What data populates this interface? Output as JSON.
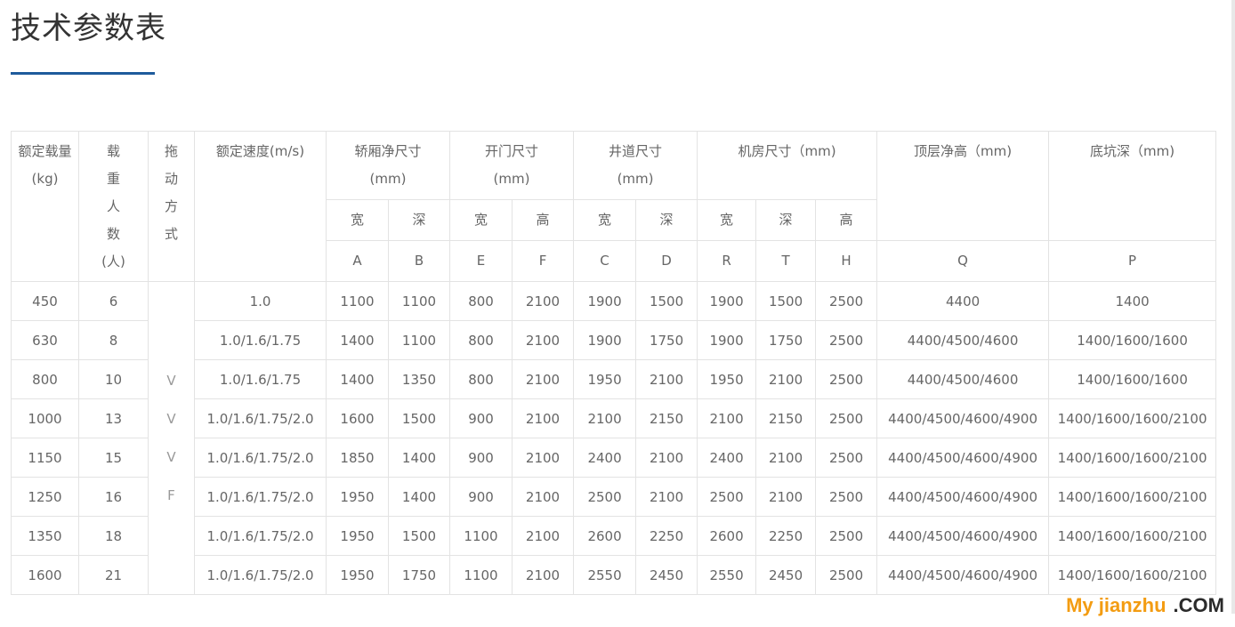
{
  "title": "技术参数表",
  "colors": {
    "accent": "#1f5b9c",
    "border": "#e3e3e3",
    "text": "#666666"
  },
  "table": {
    "headers": {
      "load": "额定载量(kg)",
      "persons": [
        "载",
        "重",
        "人",
        "数",
        "(人)"
      ],
      "drive": [
        "拖",
        "动",
        "方",
        "式"
      ],
      "speed": "额定速度(m/s)",
      "car": [
        "轿厢净尺寸",
        "(mm)"
      ],
      "door": [
        "开门尺寸",
        "(mm)"
      ],
      "shaft": [
        "井道尺寸",
        "(mm)"
      ],
      "machine": "机房尺寸（mm)",
      "overhead": "顶层净高（mm)",
      "pit": "底坑深（mm)"
    },
    "sub": [
      "宽",
      "深",
      "宽",
      "高",
      "宽",
      "深",
      "宽",
      "深",
      "高"
    ],
    "codes": [
      "A",
      "B",
      "E",
      "F",
      "C",
      "D",
      "R",
      "T",
      "H",
      "Q",
      "P"
    ],
    "drive_letters": [
      "V",
      "V",
      "V",
      "F"
    ],
    "rows": [
      {
        "load": "450",
        "persons": "6",
        "speed": "1.0",
        "A": "1100",
        "B": "1100",
        "E": "800",
        "F": "2100",
        "C": "1900",
        "D": "1500",
        "R": "1900",
        "T": "1500",
        "H": "2500",
        "Q": "4400",
        "P": "1400"
      },
      {
        "load": "630",
        "persons": "8",
        "speed": "1.0/1.6/1.75",
        "A": "1400",
        "B": "1100",
        "E": "800",
        "F": "2100",
        "C": "1900",
        "D": "1750",
        "R": "1900",
        "T": "1750",
        "H": "2500",
        "Q": "4400/4500/4600",
        "P": "1400/1600/1600"
      },
      {
        "load": "800",
        "persons": "10",
        "speed": "1.0/1.6/1.75",
        "A": "1400",
        "B": "1350",
        "E": "800",
        "F": "2100",
        "C": "1950",
        "D": "2100",
        "R": "1950",
        "T": "2100",
        "H": "2500",
        "Q": "4400/4500/4600",
        "P": "1400/1600/1600"
      },
      {
        "load": "1000",
        "persons": "13",
        "speed": "1.0/1.6/1.75/2.0",
        "A": "1600",
        "B": "1500",
        "E": "900",
        "F": "2100",
        "C": "2100",
        "D": "2150",
        "R": "2100",
        "T": "2150",
        "H": "2500",
        "Q": "4400/4500/4600/4900",
        "P": "1400/1600/1600/2100"
      },
      {
        "load": "1150",
        "persons": "15",
        "speed": "1.0/1.6/1.75/2.0",
        "A": "1850",
        "B": "1400",
        "E": "900",
        "F": "2100",
        "C": "2400",
        "D": "2100",
        "R": "2400",
        "T": "2100",
        "H": "2500",
        "Q": "4400/4500/4600/4900",
        "P": "1400/1600/1600/2100"
      },
      {
        "load": "1250",
        "persons": "16",
        "speed": "1.0/1.6/1.75/2.0",
        "A": "1950",
        "B": "1400",
        "E": "900",
        "F": "2100",
        "C": "2500",
        "D": "2100",
        "R": "2500",
        "T": "2100",
        "H": "2500",
        "Q": "4400/4500/4600/4900",
        "P": "1400/1600/1600/2100"
      },
      {
        "load": "1350",
        "persons": "18",
        "speed": "1.0/1.6/1.75/2.0",
        "A": "1950",
        "B": "1500",
        "E": "1100",
        "F": "2100",
        "C": "2600",
        "D": "2250",
        "R": "2600",
        "T": "2250",
        "H": "2500",
        "Q": "4400/4500/4600/4900",
        "P": "1400/1600/1600/2100"
      },
      {
        "load": "1600",
        "persons": "21",
        "speed": "1.0/1.6/1.75/2.0",
        "A": "1950",
        "B": "1750",
        "E": "1100",
        "F": "2100",
        "C": "2550",
        "D": "2450",
        "R": "2550",
        "T": "2450",
        "H": "2500",
        "Q": "4400/4500/4600/4900",
        "P": "1400/1600/1600/2100"
      }
    ]
  },
  "watermark": {
    "part1": "My jianzhu",
    "part2": ".COM"
  }
}
